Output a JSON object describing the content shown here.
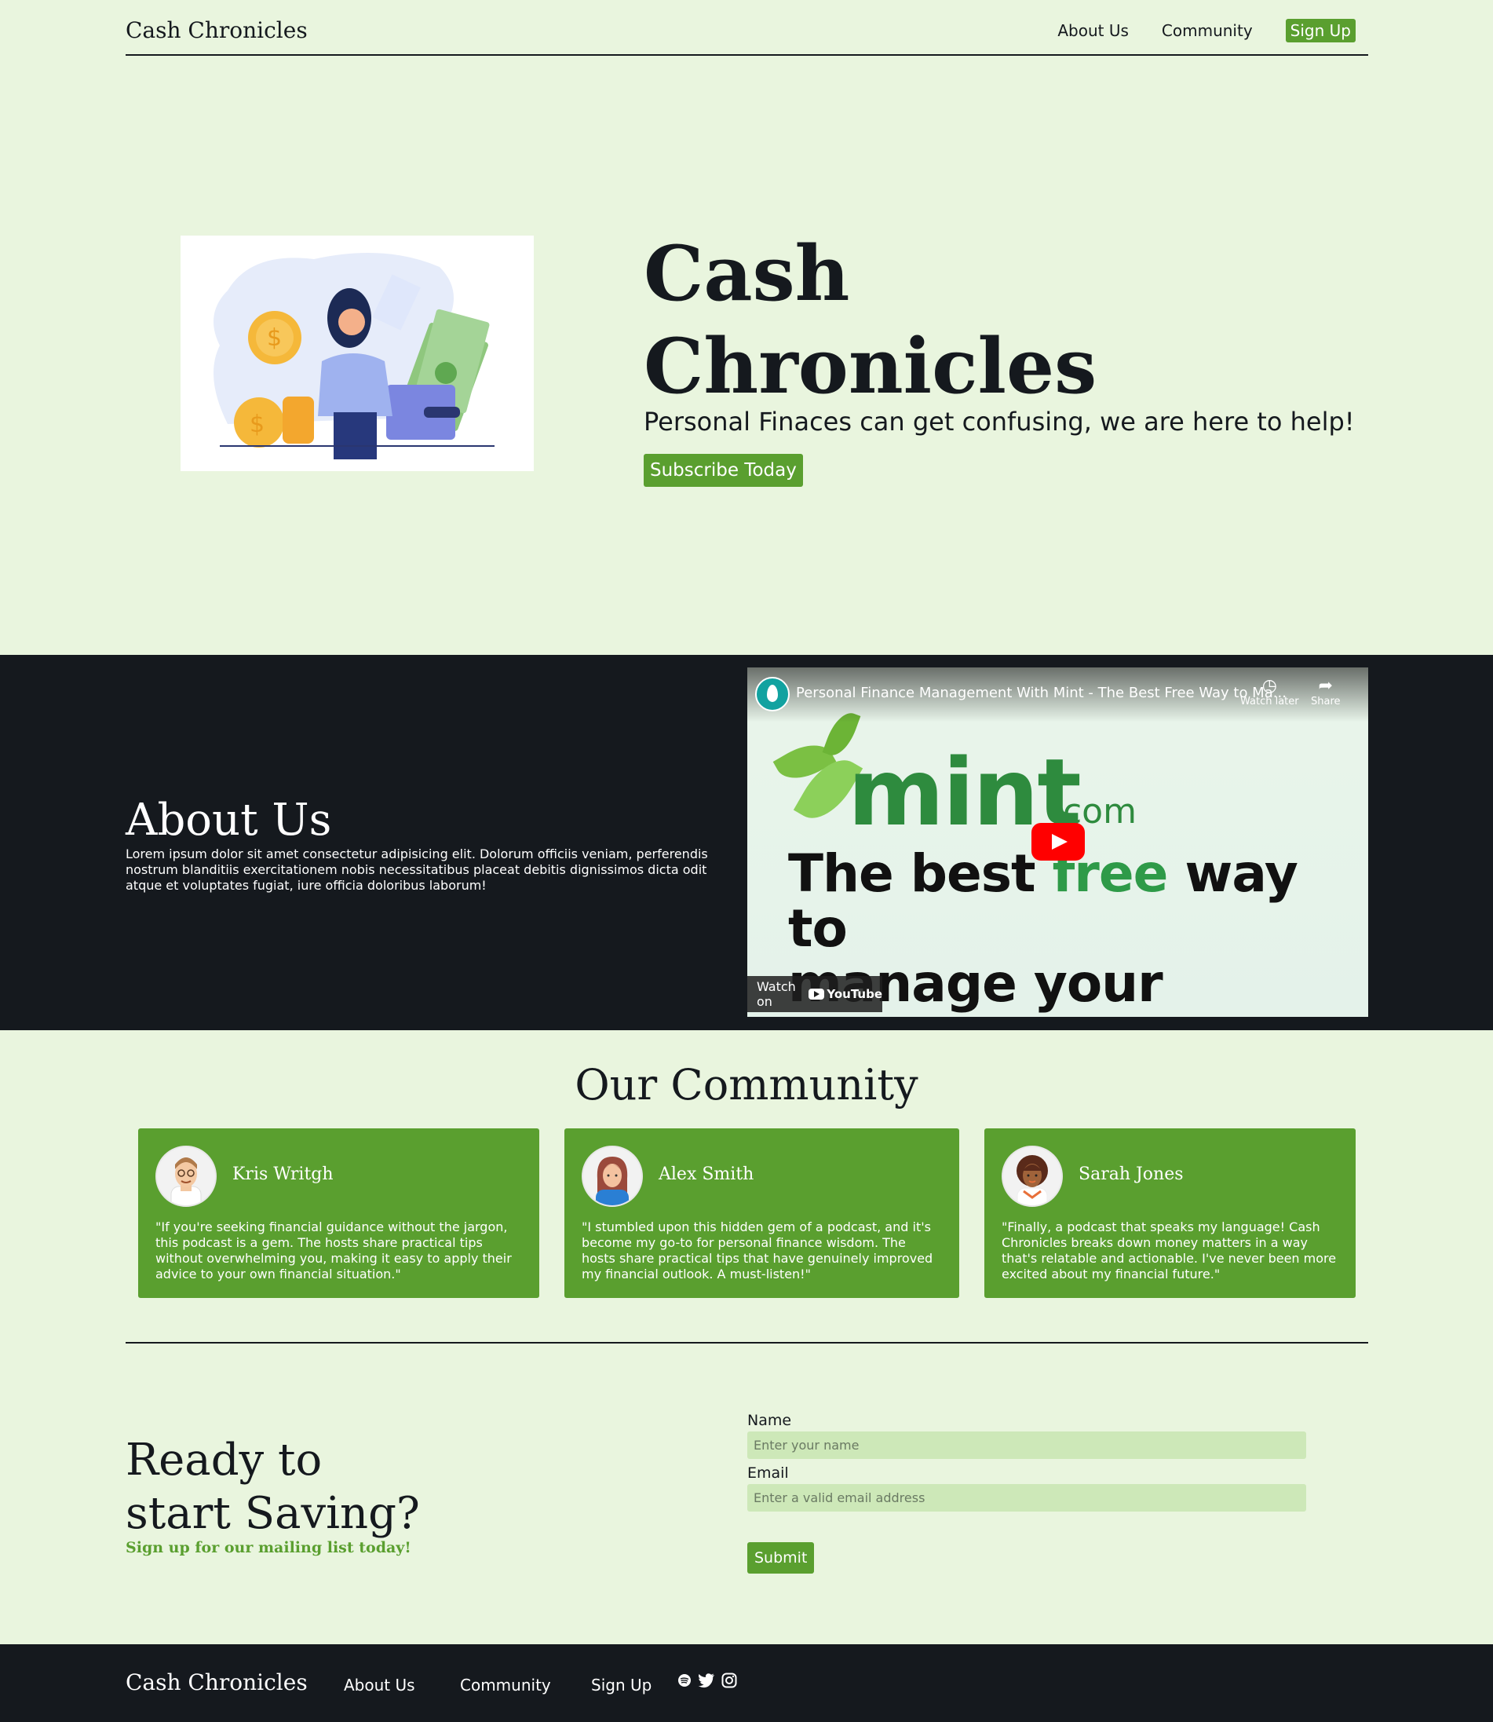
{
  "nav": {
    "brand": "Cash Chronicles",
    "links": [
      "About Us",
      "Community"
    ],
    "signup": "Sign Up"
  },
  "hero": {
    "title_line1": "Cash",
    "title_line2": "Chronicles",
    "subtitle": "Personal Finaces can get confusing, we are here to help!",
    "cta": "Subscribe Today"
  },
  "about": {
    "heading": "About Us",
    "body": "Lorem ipsum dolor sit amet consectetur adipisicing elit. Dolorum officiis veniam, perferendis nostrum blanditiis exercitationem nobis necessitatibus placeat debitis dignissimos dicta odit atque et voluptates fugiat, iure officia doloribus laborum!",
    "video": {
      "title": "Personal Finance Management With Mint - The Best Free Way to Ma...",
      "watch_later": "Watch later",
      "share": "Share",
      "brand_word": "mint",
      "brand_suffix": ".com",
      "tagline_pre": "The best ",
      "tagline_free": "free",
      "tagline_post": " way to",
      "tagline_line2": "manage your money.",
      "watch_on": "Watch on",
      "youtube": "YouTube"
    }
  },
  "community": {
    "heading": "Our Community",
    "testimonials": [
      {
        "name": "Kris Writgh",
        "quote": "\"If you're seeking financial guidance without the jargon, this podcast is a gem. The hosts share practical tips without overwhelming you, making it easy to apply their advice to your own financial situation.\""
      },
      {
        "name": "Alex Smith",
        "quote": "\"I stumbled upon this hidden gem of a podcast, and it's become my go-to for personal finance wisdom. The hosts share practical tips that have genuinely improved my financial outlook. A must-listen!\""
      },
      {
        "name": "Sarah Jones",
        "quote": "\"Finally, a podcast that speaks my language! Cash Chronicles breaks down money matters in a way that's relatable and actionable. I've never been more excited about my financial future.\""
      }
    ]
  },
  "signup": {
    "heading_line1": "Ready to",
    "heading_line2": "start Saving?",
    "sub": "Sign up for our mailing list today!",
    "name_label": "Name",
    "name_placeholder": "Enter your name",
    "email_label": "Email",
    "email_placeholder": "Enter a valid email address",
    "submit": "Submit"
  },
  "footer": {
    "brand": "Cash Chronicles",
    "links": [
      "About Us",
      "Community",
      "Sign Up"
    ],
    "icons": [
      "spotify-icon",
      "twitter-icon",
      "instagram-icon"
    ]
  },
  "colors": {
    "background": "#e9f5de",
    "accent": "#5a9f2f",
    "dark": "#15191e"
  }
}
